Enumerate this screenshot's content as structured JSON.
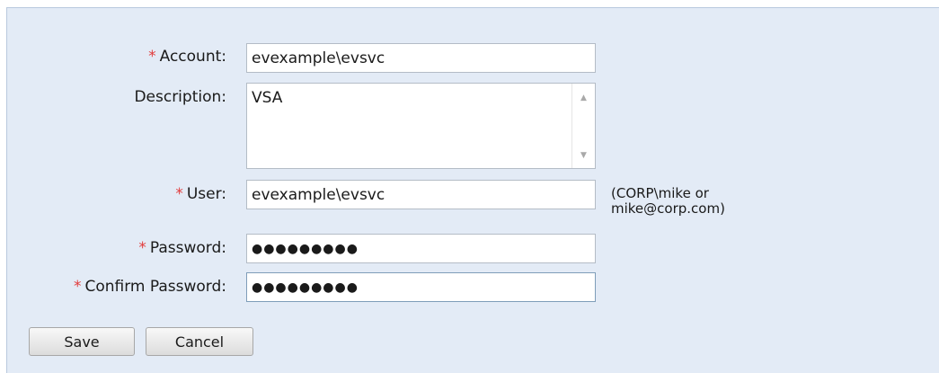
{
  "form": {
    "required_marker": "*",
    "account": {
      "label": "Account:",
      "value": "evexample\\evsvc"
    },
    "description": {
      "label": "Description:",
      "value": "VSA"
    },
    "user": {
      "label": "User:",
      "value": "evexample\\evsvc",
      "hint_line1": "(CORP\\mike or",
      "hint_line2": "mike@corp.com)"
    },
    "password": {
      "label": "Password:",
      "value": "●●●●●●●●●"
    },
    "confirm_password": {
      "label": "Confirm Password:",
      "value": "●●●●●●●●●"
    }
  },
  "buttons": {
    "save_label": "Save",
    "cancel_label": "Cancel"
  },
  "colors": {
    "panel_bg": "#e3ebf6",
    "required": "#e23b3b"
  },
  "icons": {
    "scroll_up": "scroll-up-arrow-icon",
    "scroll_down": "scroll-down-arrow-icon"
  }
}
